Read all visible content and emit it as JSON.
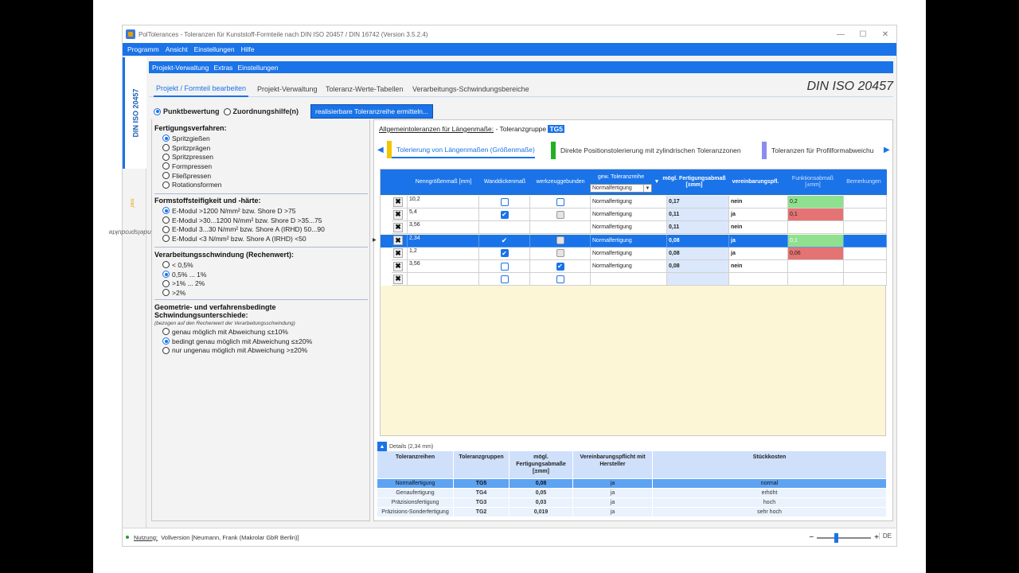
{
  "window": {
    "title": "PolTolerances - Toleranzen für Kunststoff-Formteile nach DIN ISO 20457 / DIN 16742 (Version 3.5.2.4)",
    "controls": [
      "—",
      "☐",
      "✕"
    ]
  },
  "menubar": [
    "Programm",
    "Ansicht",
    "Einstellungen",
    "Hilfe"
  ],
  "sidetabs": {
    "tab1": "DIN ISO 20457",
    "tab2": "Handelsprodukte",
    "tab2_sup": "plus"
  },
  "submenu": [
    "Projekt-Verwaltung",
    "Extras",
    "Einstellungen"
  ],
  "tabs": [
    "Projekt / Formteil bearbeiten",
    "Projekt-Verwaltung",
    "Toleranz-Werte-Tabellen",
    "Verarbeitungs-Schwindungsbereiche"
  ],
  "din_label": "DIN ISO 20457",
  "modes": {
    "punkt": "Punktbewertung",
    "zuordnung": "Zuordnungshilfe(n)",
    "button": "realisierbare Toleranzreihe ermitteln..."
  },
  "groups": {
    "fertigung": {
      "title": "Fertigungsverfahren:",
      "options": [
        "Spritzgießen",
        "Spritzprägen",
        "Spritzpressen",
        "Formpressen",
        "Fließpressen",
        "Rotationsformen"
      ]
    },
    "steifigkeit": {
      "title": "Formstoffsteifigkeit und -härte:",
      "options": [
        "E-Modul >1200 N/mm² bzw. Shore D >75",
        "E-Modul >30...1200 N/mm² bzw. Shore D >35...75",
        "E-Modul 3...30 N/mm² bzw. Shore A (IRHD) 50...90",
        "E-Modul <3 N/mm² bzw. Shore A (IRHD) <50"
      ]
    },
    "schwindung": {
      "title": "Verarbeitungsschwindung (Rechenwert):",
      "options": [
        "< 0,5%",
        "0,5% ... 1%",
        ">1% ... 2%",
        ">2%"
      ]
    },
    "geometrie": {
      "title": "Geometrie- und verfahrensbedingte Schwindungsunterschiede:",
      "note": "(bezogen auf den Rechenwert der Verarbeitungsschwindung)",
      "options": [
        "genau möglich mit Abweichung ≤±10%",
        "bedingt genau möglich mit Abweichung ≤±20%",
        "nur ungenau möglich mit Abweichung >±20%"
      ]
    }
  },
  "right": {
    "title_u": "Allgemeintoleranzen für Längenmaße:",
    "title_rest": " - Toleranzgruppe ",
    "tg": "TG5",
    "subtabs": [
      "Tolerierung von Längenmaßen (Größenmaße)",
      "Direkte Positionstolerierung mit zylindrischen Toleranzzonen",
      "Toleranzen für Profilformabweichu"
    ],
    "subtab_colors": [
      "#f5c400",
      "#22b022",
      "#8c8cf0"
    ]
  },
  "grid": {
    "headers": {
      "nenn": "Nenngrößenmaß [mm]",
      "wand": "Wanddickenmaß",
      "werkzeug": "werkzeuggebunden",
      "reihe": "gew. Toleranzreihe",
      "reihe_sel": "Normalfertigung",
      "fert": "mögl. Fertigungsabmaß [±mm]",
      "verein": "vereinbarungspfl.",
      "funk": "Funktionsabmaß [±mm]",
      "bem": "Bemerkungen"
    },
    "rows": [
      {
        "nenn": "10,2",
        "wand": "off",
        "werkzeug": "off",
        "reihe": "Normalfertigung",
        "fert": "0,17",
        "verein": "nein",
        "funk": "0,2",
        "funk_color": "green"
      },
      {
        "nenn": "5,4",
        "wand": "on",
        "werkzeug": "grey",
        "reihe": "Normalfertigung",
        "fert": "0,11",
        "verein": "ja",
        "funk": "0,1",
        "funk_color": "red"
      },
      {
        "nenn": "3,56",
        "wand": "none",
        "werkzeug": "none",
        "reihe": "Normalfertigung",
        "fert": "0,11",
        "verein": "nein",
        "funk": "",
        "funk_color": ""
      },
      {
        "nenn": "2,34",
        "wand": "tick",
        "werkzeug": "grey",
        "reihe": "Normalfertigung",
        "fert": "0,08",
        "verein": "ja",
        "funk": "0,1",
        "funk_color": "green"
      },
      {
        "nenn": "1,2",
        "wand": "on",
        "werkzeug": "grey",
        "reihe": "Normalfertigung",
        "fert": "0,08",
        "verein": "ja",
        "funk": "0,06",
        "funk_color": "red"
      },
      {
        "nenn": "3,56",
        "wand": "off",
        "werkzeug": "on",
        "reihe": "Normalfertigung",
        "fert": "0,08",
        "verein": "nein",
        "funk": "",
        "funk_color": ""
      },
      {
        "nenn": "",
        "wand": "off",
        "werkzeug": "off",
        "reihe": "",
        "fert": "",
        "verein": "",
        "funk": "",
        "funk_color": ""
      }
    ]
  },
  "details": {
    "label": "Details (2,34 mm)",
    "headers": [
      "Toleranzreihen",
      "Toleranzgruppen",
      "mögl. Fertigungsabmaße [±mm]",
      "Vereinbarungspflicht mit Hersteller",
      "Stückkosten"
    ],
    "rows": [
      [
        "Normalfertigung",
        "TG5",
        "0,08",
        "ja",
        "normal"
      ],
      [
        "Genaufertigung",
        "TG4",
        "0,05",
        "ja",
        "erhöht"
      ],
      [
        "Präzisionsfertigung",
        "TG3",
        "0,03",
        "ja",
        "hoch"
      ],
      [
        "Präzisions-Sonderfertigung",
        "TG2",
        "0,019",
        "ja",
        "sehr hoch"
      ]
    ]
  },
  "status": {
    "label": "Nutzung:",
    "value": "Vollversion [Neumann, Frank (Makrolar GbR Berlin)]",
    "lang": "DE"
  },
  "colors": {
    "accent": "#1a73e8",
    "green": "#8fe08f",
    "red": "#e57373",
    "grid_bg": "#fdf6d6"
  }
}
